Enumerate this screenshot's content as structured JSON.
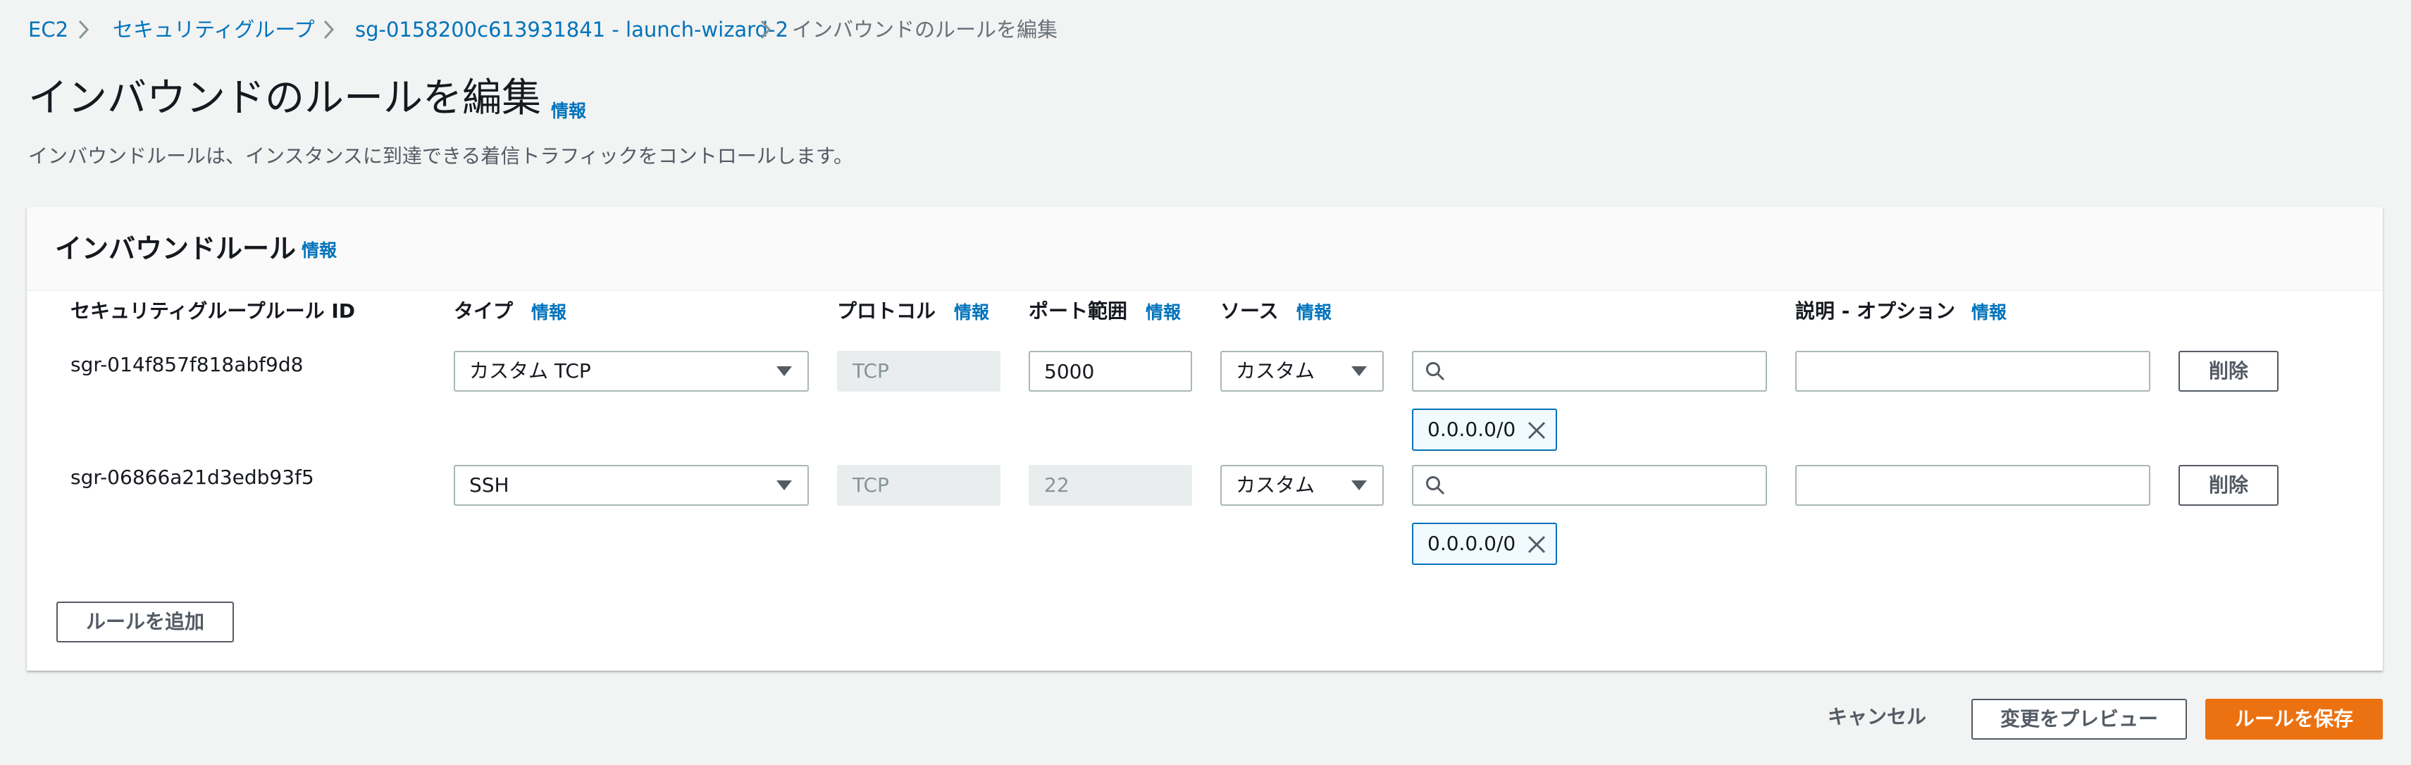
{
  "breadcrumb": {
    "items": [
      "EC2",
      "セキュリティグループ",
      "sg-0158200c613931841 - launch-wizard-2"
    ],
    "current": "インバウンドのルールを編集"
  },
  "page": {
    "title": "インバウンドのルールを編集",
    "info_label": "情報",
    "description": "インバウンドルールは、インスタンスに到達できる着信トラフィックをコントロールします。"
  },
  "panel": {
    "title": "インバウンドルール",
    "info_label": "情報",
    "columns": {
      "rule_id": "セキュリティグループルール ID",
      "type": "タイプ",
      "protocol": "プロトコル",
      "port_range": "ポート範囲",
      "source": "ソース",
      "description": "説明 - オプション"
    },
    "rules": [
      {
        "id": "sgr-014f857f818abf9d8",
        "type": "カスタム TCP",
        "protocol": "TCP",
        "port_range": "5000",
        "source": "カスタム",
        "search_value": "",
        "cidr": "0.0.0.0/0",
        "description_value": "",
        "delete_label": "削除"
      },
      {
        "id": "sgr-06866a21d3edb93f5",
        "type": "SSH",
        "protocol": "TCP",
        "port_range": "22",
        "source": "カスタム",
        "search_value": "",
        "cidr": "0.0.0.0/0",
        "description_value": "",
        "delete_label": "削除"
      }
    ],
    "add_rule_label": "ルールを追加"
  },
  "footer": {
    "cancel_label": "キャンセル",
    "preview_label": "変更をプレビュー",
    "save_label": "ルールを保存"
  },
  "colors": {
    "link": "#0073bb",
    "primary": "#ec7211",
    "background": "#f2f3f3"
  }
}
